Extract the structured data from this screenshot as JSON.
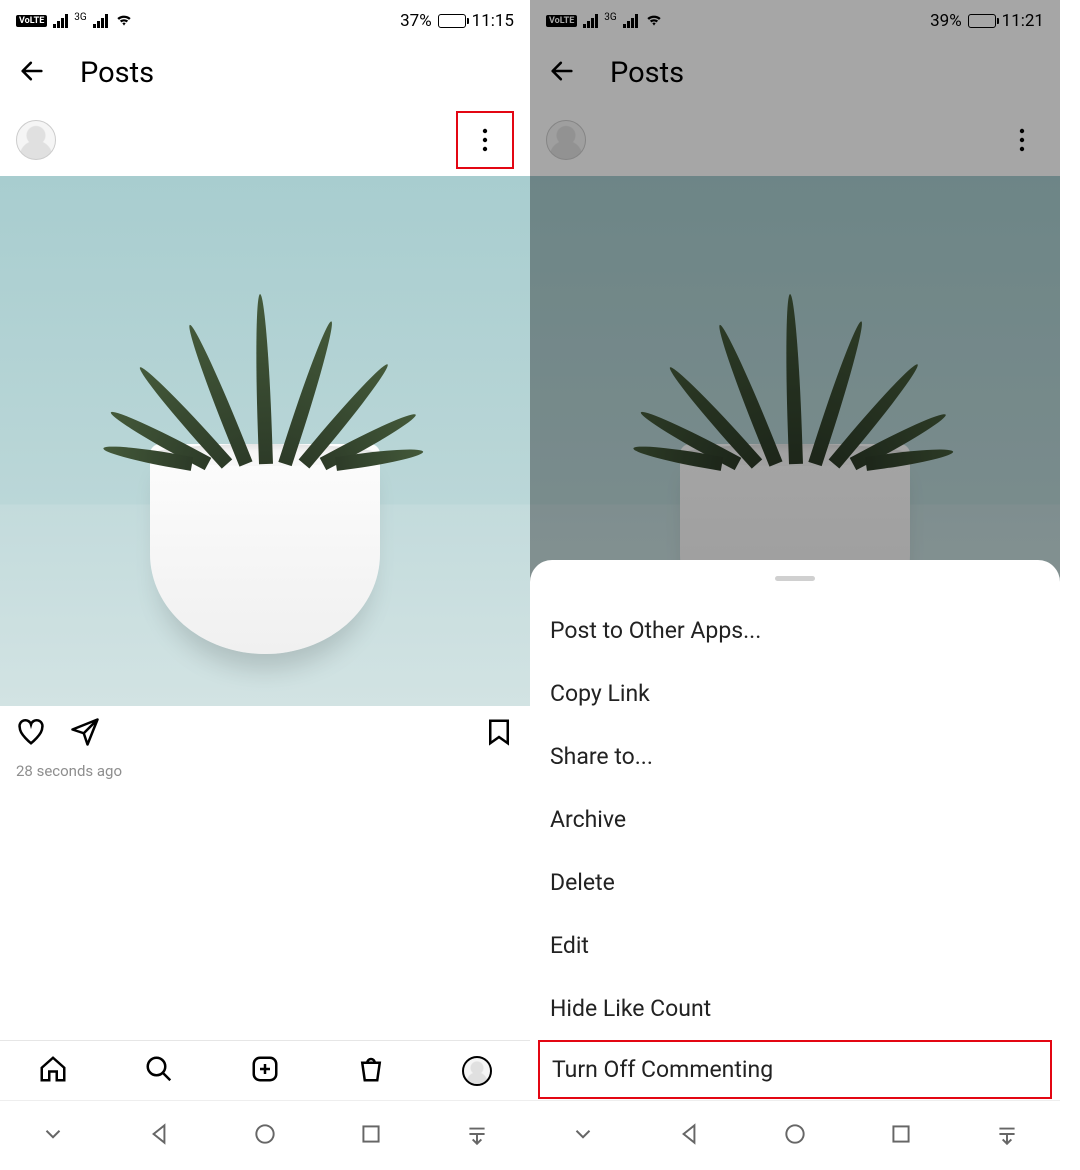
{
  "left": {
    "status": {
      "battery_pct": "37%",
      "time": "11:15",
      "net_label": "3G"
    },
    "header": {
      "title": "Posts"
    },
    "post": {
      "timestamp": "28 seconds ago"
    }
  },
  "right": {
    "status": {
      "battery_pct": "39%",
      "time": "11:21",
      "net_label": "3G"
    },
    "header": {
      "title": "Posts"
    },
    "sheet": {
      "items": [
        "Post to Other Apps...",
        "Copy Link",
        "Share to...",
        "Archive",
        "Delete",
        "Edit",
        "Hide Like Count",
        "Turn Off Commenting"
      ]
    }
  }
}
